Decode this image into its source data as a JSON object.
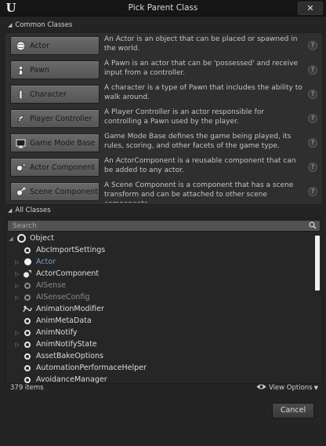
{
  "window": {
    "title": "Pick Parent Class",
    "close_label": "✕"
  },
  "common": {
    "header": "Common Classes",
    "items": [
      {
        "label": "Actor",
        "icon": "sphere-icon",
        "desc": "An Actor is an object that can be placed or spawned in the world."
      },
      {
        "label": "Pawn",
        "icon": "pawn-icon",
        "desc": "A Pawn is an actor that can be 'possessed' and receive input from a controller."
      },
      {
        "label": "Character",
        "icon": "character-icon",
        "desc": "A character is a type of Pawn that includes the ability to walk around."
      },
      {
        "label": "Player Controller",
        "icon": "controller-icon",
        "desc": "A Player Controller is an actor responsible for controlling a Pawn used by the player."
      },
      {
        "label": "Game Mode Base",
        "icon": "monitor-icon",
        "desc": "Game Mode Base defines the game being played, its rules, scoring, and other facets of the game type."
      },
      {
        "label": "Actor Component",
        "icon": "component-icon",
        "desc": "An ActorComponent is a reusable component that can be added to any actor."
      },
      {
        "label": "Scene Component",
        "icon": "scene-component-icon",
        "desc": "A Scene Component is a component that has a scene transform and can be attached to other scene components."
      }
    ],
    "help": "?"
  },
  "all": {
    "header": "All Classes",
    "search_placeholder": "Search",
    "tree": [
      {
        "label": "Object",
        "level": 0,
        "expander": "◢",
        "icon": "ring",
        "color": "#dcdcdc"
      },
      {
        "label": "AbcImportSettings",
        "level": 1,
        "expander": "",
        "icon": "ring",
        "color": "#dcdcdc"
      },
      {
        "label": "Actor",
        "level": 1,
        "expander": "▷",
        "icon": "dot",
        "color": "#6f9fc9"
      },
      {
        "label": "ActorComponent",
        "level": 1,
        "expander": "▷",
        "icon": "component",
        "color": "#dcdcdc"
      },
      {
        "label": "AISense",
        "level": 1,
        "expander": "▷",
        "icon": "ring-dim",
        "color": "#8c8c8c"
      },
      {
        "label": "AISenseConfig",
        "level": 1,
        "expander": "▷",
        "icon": "ring-dim",
        "color": "#8c8c8c"
      },
      {
        "label": "AnimationModifier",
        "level": 1,
        "expander": "",
        "icon": "anim-mod",
        "color": "#dcdcdc"
      },
      {
        "label": "AnimMetaData",
        "level": 1,
        "expander": "",
        "icon": "ring",
        "color": "#dcdcdc"
      },
      {
        "label": "AnimNotify",
        "level": 1,
        "expander": "▷",
        "icon": "ring",
        "color": "#dcdcdc"
      },
      {
        "label": "AnimNotifyState",
        "level": 1,
        "expander": "▷",
        "icon": "ring",
        "color": "#dcdcdc"
      },
      {
        "label": "AssetBakeOptions",
        "level": 1,
        "expander": "",
        "icon": "ring",
        "color": "#dcdcdc"
      },
      {
        "label": "AutomationPerformaceHelper",
        "level": 1,
        "expander": "",
        "icon": "ring",
        "color": "#dcdcdc"
      },
      {
        "label": "AvoidanceManager",
        "level": 1,
        "expander": "",
        "icon": "ring",
        "color": "#dcdcdc"
      }
    ],
    "item_count": "379 items",
    "view_options": "View Options"
  },
  "footer": {
    "cancel_label": "Cancel"
  }
}
